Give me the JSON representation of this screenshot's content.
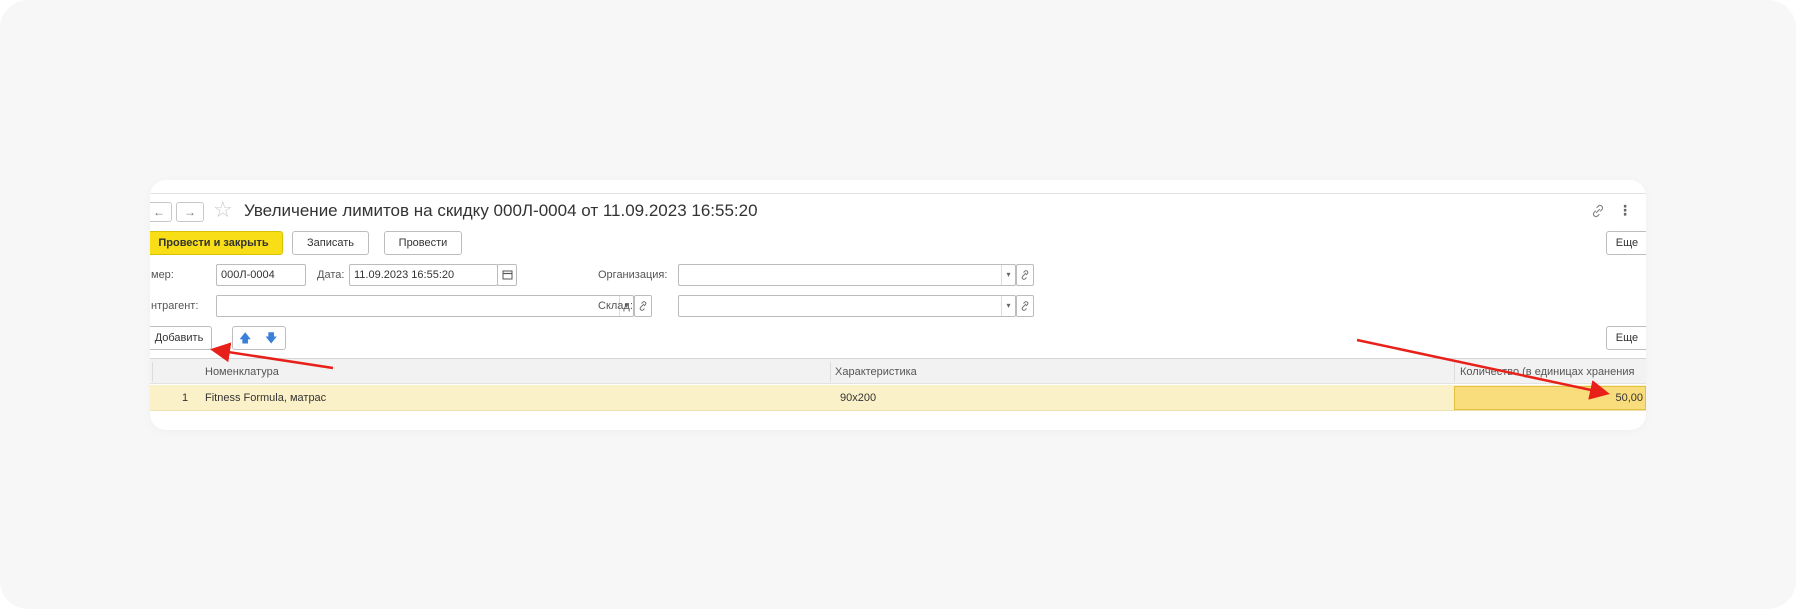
{
  "window": {
    "back_glyph": "←",
    "forward_glyph": "→",
    "star_glyph": "☆",
    "title": "Увеличение лимитов на скидку 000Л-0004 от 11.09.2023 16:55:20",
    "more_glyph": "⋮"
  },
  "toolbar": {
    "post_and_close": "Провести и закрыть",
    "save": "Записать",
    "post": "Провести",
    "more": "Еще"
  },
  "form": {
    "number_label": "мер:",
    "number_value": "000Л-0004",
    "date_label": "Дата:",
    "date_value": "11.09.2023 16:55:20",
    "organization_label": "Организация:",
    "organization_value": "",
    "counterparty_label": "нтрагент:",
    "counterparty_value": "",
    "warehouse_label": "Склад:",
    "warehouse_value": ""
  },
  "table_toolbar": {
    "add": "Добавить",
    "up_glyph": "🡅",
    "down_glyph": "🡇",
    "more": "Еще"
  },
  "table": {
    "columns": [
      "Номенклатура",
      "Характеристика",
      "Количество (в единицах хранения"
    ],
    "rows": [
      {
        "n": "1",
        "nomenclature": "Fitness Formula, матрас",
        "characteristic": "90x200",
        "quantity": "50,00"
      }
    ]
  },
  "colors": {
    "primary_button": "#f7de16",
    "selected_row": "#fbf1c9",
    "active_cell": "#f9dd7c",
    "annotation_arrow": "#e8201a",
    "nav_arrow_blue": "#3a7fd9"
  }
}
